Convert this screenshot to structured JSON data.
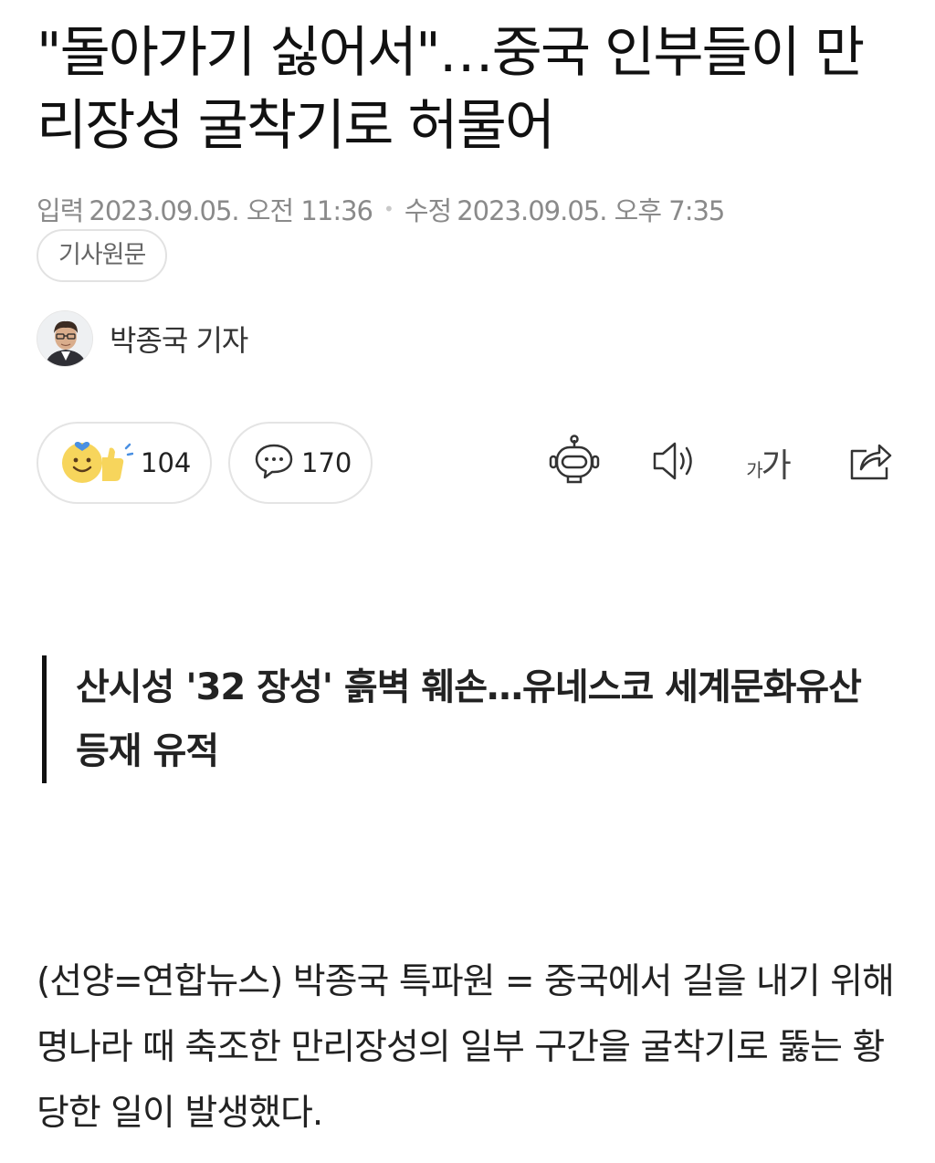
{
  "article": {
    "headline": "\"돌아가기 싫어서\"…중국 인부들이 만리장성 굴착기로 허물어",
    "meta": {
      "input_label": "입력",
      "input_date": "2023.09.05. 오전 11:36",
      "modified_label": "수정",
      "modified_date": "2023.09.05. 오후 7:35"
    },
    "original_button": "기사원문",
    "reporter": {
      "name": "박종국 기자"
    },
    "reactions": {
      "count": "104",
      "icon": "smile-thumbs-reaction-icon"
    },
    "comments": {
      "count": "170",
      "icon": "speech-bubble-icon"
    },
    "tools": {
      "summary_icon": "robot-icon",
      "audio_icon": "speaker-icon",
      "font_size_label": "가가",
      "share_icon": "share-icon"
    },
    "subtitle": "산시성 '32 장성' 흙벽 훼손…유네스코 세계문화유산 등재 유적",
    "body": "(선양=연합뉴스) 박종국 특파원 = 중국에서 길을 내기 위해 명나라 때 축조한 만리장성의 일부 구간을 굴착기로 뚫는 황당한 일이 발생했다."
  }
}
